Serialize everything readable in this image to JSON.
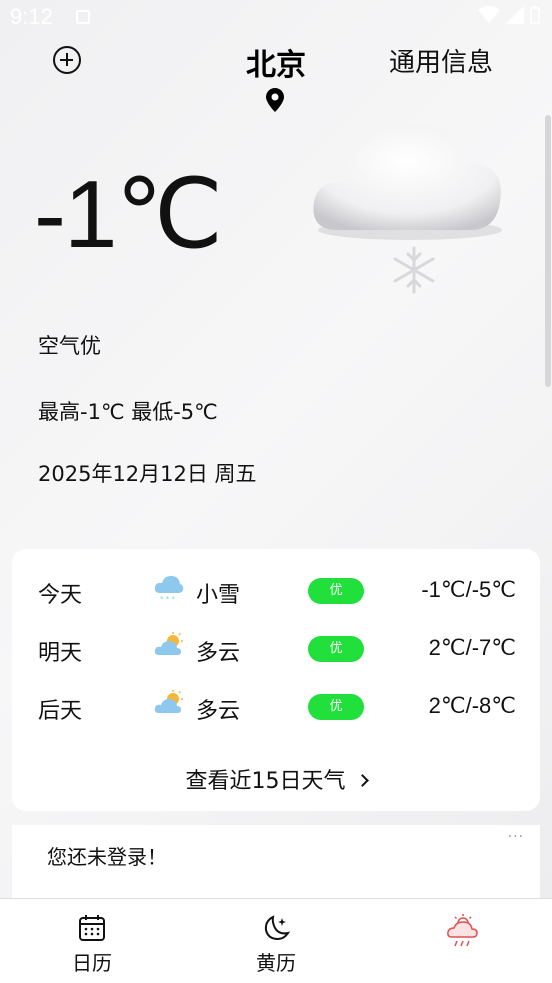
{
  "status_bar": {
    "time": "9:12"
  },
  "header": {
    "city": "北京",
    "general_info": "通用信息"
  },
  "current": {
    "temperature": "-1℃",
    "air_quality": "空气优",
    "high_low": "最高-1℃ 最低-5℃",
    "date": "2025年12月12日 周五"
  },
  "forecast": {
    "rows": [
      {
        "day": "今天",
        "icon": "snow-cloud-icon",
        "condition": "小雪",
        "aqi": "优",
        "range": "-1℃/-5℃"
      },
      {
        "day": "明天",
        "icon": "partly-cloudy-icon",
        "condition": "多云",
        "aqi": "优",
        "range": "2℃/-7℃"
      },
      {
        "day": "后天",
        "icon": "partly-cloudy-icon",
        "condition": "多云",
        "aqi": "优",
        "range": "2℃/-8℃"
      }
    ],
    "more_label": "查看近15日天气"
  },
  "login": {
    "message": "您还未登录！",
    "more": "···"
  },
  "bottom_nav": {
    "items": [
      {
        "label": "日历",
        "icon": "calendar-icon"
      },
      {
        "label": "黄历",
        "icon": "moon-stars-icon"
      },
      {
        "label": "",
        "icon": "weather-icon"
      }
    ]
  },
  "colors": {
    "aqi_good": "#22e03c",
    "active_tab": "#e05050"
  }
}
